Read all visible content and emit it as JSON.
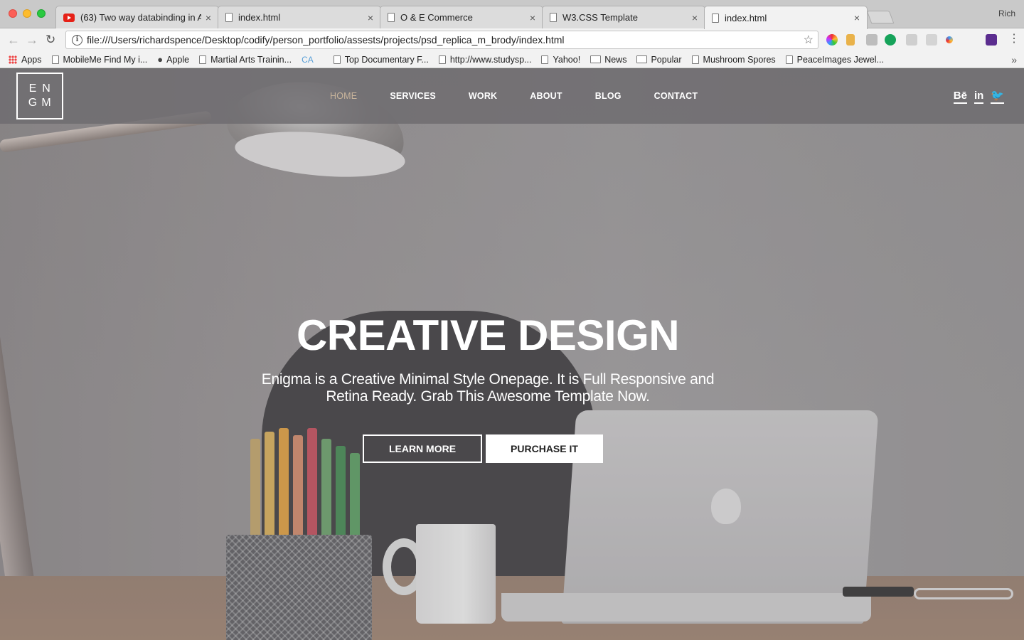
{
  "browser": {
    "tabs": [
      {
        "label": "(63) Two way databinding in A",
        "icon": "youtube-icon"
      },
      {
        "label": "index.html",
        "icon": "document-icon"
      },
      {
        "label": "O & E Commerce",
        "icon": "document-icon"
      },
      {
        "label": "W3.CSS Template",
        "icon": "document-icon"
      },
      {
        "label": "index.html",
        "icon": "document-icon",
        "active": true
      }
    ],
    "close_glyph": "×",
    "profile_name": "Rich",
    "url": "file:///Users/richardspence/Desktop/codify/person_portfolio/assests/projects/psd_replica_m_brody/index.html",
    "bookmarks": [
      {
        "label": "Apps",
        "icon": "apps-icon"
      },
      {
        "label": "MobileMe Find My i...",
        "icon": "document-icon"
      },
      {
        "label": "Apple",
        "icon": "apple-icon"
      },
      {
        "label": "Martial Arts Trainin...",
        "icon": "document-icon"
      },
      {
        "label": "CA",
        "icon": "text-badge"
      },
      {
        "label": "Top Documentary F...",
        "icon": "document-icon"
      },
      {
        "label": "http://www.studysp...",
        "icon": "document-icon"
      },
      {
        "label": "Yahoo!",
        "icon": "document-icon"
      },
      {
        "label": "News",
        "icon": "folder-icon"
      },
      {
        "label": "Popular",
        "icon": "folder-icon"
      },
      {
        "label": "Mushroom Spores",
        "icon": "document-icon"
      },
      {
        "label": "PeaceImages Jewel...",
        "icon": "document-icon"
      }
    ],
    "overflow_glyph": "»"
  },
  "site": {
    "logo_letters": [
      "E",
      "N",
      "G",
      "M"
    ],
    "nav": [
      {
        "label": "HOME",
        "active": true
      },
      {
        "label": "SERVICES"
      },
      {
        "label": "WORK"
      },
      {
        "label": "ABOUT"
      },
      {
        "label": "BLOG"
      },
      {
        "label": "CONTACT"
      }
    ],
    "social": [
      "Bē",
      "in",
      "🐦"
    ],
    "hero": {
      "title": "CREATIVE DESIGN",
      "subtitle_line1": "Enigma is a Creative Minimal Style Onepage. It is Full Responsive and",
      "subtitle_line2": "Retina Ready. Grab This Awesome Template Now.",
      "learn_more": "LEARN MORE",
      "purchase": "PURCHASE IT"
    },
    "colors": {
      "nav_active": "#c8b49b",
      "nav_bg": "#6e6c70"
    }
  }
}
